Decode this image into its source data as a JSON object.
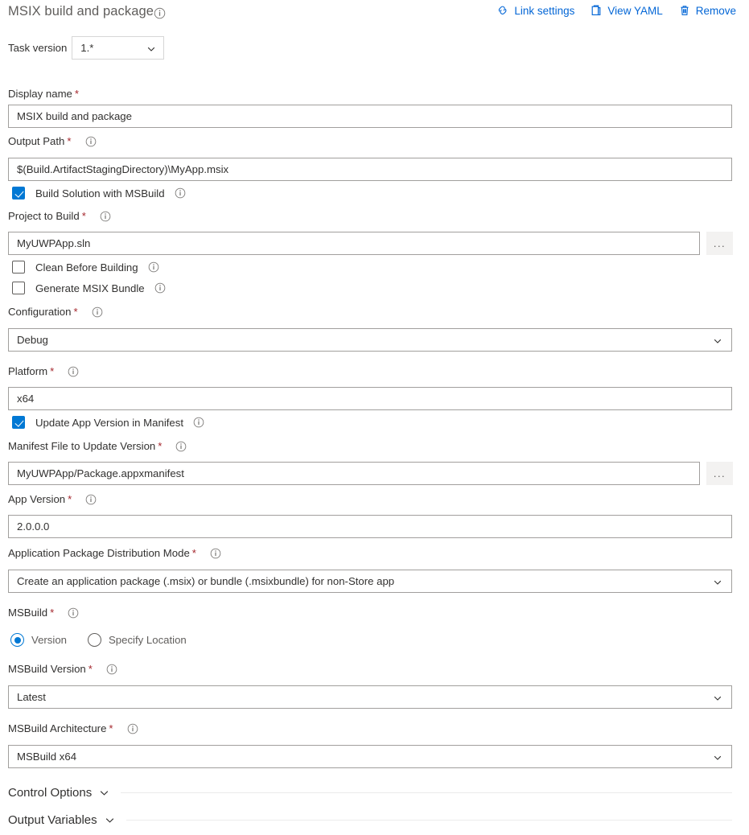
{
  "header": {
    "task_title": "MSIX build and package",
    "title_info_icon": "info-icon",
    "toolbar": [
      {
        "label": "Link settings",
        "icon": "link-icon"
      },
      {
        "label": "View YAML",
        "icon": "clipboard-icon"
      },
      {
        "label": "Remove",
        "icon": "trash-icon"
      }
    ]
  },
  "task_version": {
    "label": "Task version",
    "value": "1.*",
    "chevron_icon": "chevron-down-icon"
  },
  "fields": {
    "display_name": {
      "label": "Display name",
      "required": "*",
      "value": "MSIX build and package"
    },
    "output_path": {
      "label": "Output Path",
      "required": "*",
      "info_icon": "info-icon",
      "value": "$(Build.ArtifactStagingDirectory)\\MyApp.msix"
    },
    "build_solution": {
      "label": "Build Solution with MSBuild",
      "checked": true,
      "info_icon": "info-icon"
    },
    "project_to_build": {
      "label": "Project to Build",
      "required": "*",
      "info_icon": "info-icon",
      "value": "MyUWPApp.sln",
      "browse_label": "..."
    },
    "clean_before_building": {
      "label": "Clean Before Building",
      "checked": false,
      "info_icon": "info-icon"
    },
    "generate_msix_bundle": {
      "label": "Generate MSIX Bundle",
      "checked": false,
      "info_icon": "info-icon"
    },
    "configuration": {
      "label": "Configuration",
      "required": "*",
      "info_icon": "info-icon",
      "value": "Debug",
      "chevron_icon": "chevron-down-icon"
    },
    "platform": {
      "label": "Platform",
      "required": "*",
      "info_icon": "info-icon",
      "value": "x64"
    },
    "update_app_version": {
      "label": "Update App Version in Manifest",
      "checked": true,
      "info_icon": "info-icon"
    },
    "manifest_file": {
      "label": "Manifest File to Update Version",
      "required": "*",
      "info_icon": "info-icon",
      "value": "MyUWPApp/Package.appxmanifest",
      "browse_label": "..."
    },
    "app_version": {
      "label": "App Version",
      "required": "*",
      "info_icon": "info-icon",
      "value": "2.0.0.0"
    },
    "distribution_mode": {
      "label": "Application Package Distribution Mode",
      "required": "*",
      "info_icon": "info-icon",
      "value": "Create an application package (.msix) or bundle (.msixbundle) for non-Store app",
      "chevron_icon": "chevron-down-icon"
    },
    "msbuild": {
      "label": "MSBuild",
      "required": "*",
      "info_icon": "info-icon",
      "options": [
        {
          "label": "Version",
          "selected": true
        },
        {
          "label": "Specify Location",
          "selected": false
        }
      ]
    },
    "msbuild_version": {
      "label": "MSBuild Version",
      "required": "*",
      "info_icon": "info-icon",
      "value": "Latest",
      "chevron_icon": "chevron-down-icon"
    },
    "msbuild_architecture": {
      "label": "MSBuild Architecture",
      "required": "*",
      "info_icon": "info-icon",
      "value": "MSBuild x64",
      "chevron_icon": "chevron-down-icon"
    }
  },
  "sections": [
    {
      "title": "Control Options",
      "chevron_icon": "chevron-down-icon"
    },
    {
      "title": "Output Variables",
      "chevron_icon": "chevron-down-icon"
    }
  ],
  "colors": {
    "link_blue": "#0366d6",
    "accent_blue": "#0078d4",
    "required_red": "#a4262c",
    "label_gray": "#323130",
    "border_gray": "#a19f9d"
  }
}
